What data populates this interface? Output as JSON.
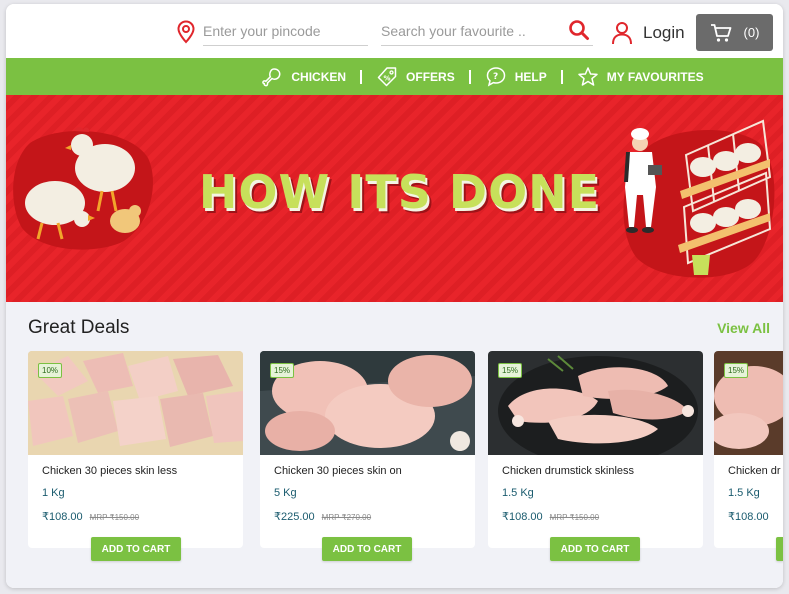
{
  "header": {
    "pincode_placeholder": "Enter your pincode",
    "search_placeholder": "Search your favourite ..",
    "login_label": "Login",
    "cart_count": "(0)"
  },
  "nav": {
    "items": [
      {
        "label": "CHICKEN",
        "icon": "chicken-leg-icon"
      },
      {
        "label": "OFFERS",
        "icon": "offer-tag-icon"
      },
      {
        "label": "HELP",
        "icon": "help-chat-icon"
      },
      {
        "label": "MY FAVOURITES",
        "icon": "star-icon"
      }
    ]
  },
  "banner": {
    "title": "HOW ITS DONE"
  },
  "deals": {
    "title": "Great Deals",
    "view_all": "View All",
    "products": [
      {
        "discount": "10%",
        "name": "Chicken 30 pieces skin less",
        "qty": "1 Kg",
        "price": "₹108.00",
        "mrp": "MRP ₹150.00",
        "add_label": "ADD TO CART"
      },
      {
        "discount": "15%",
        "name": "Chicken 30 pieces skin on",
        "qty": "5 Kg",
        "price": "₹225.00",
        "mrp": "MRP ₹270.00",
        "add_label": "ADD TO CART"
      },
      {
        "discount": "15%",
        "name": "Chicken drumstick skinless",
        "qty": "1.5 Kg",
        "price": "₹108.00",
        "mrp": "MRP ₹150.00",
        "add_label": "ADD TO CART"
      },
      {
        "discount": "15%",
        "name": "Chicken dr",
        "qty": "1.5 Kg",
        "price": "₹108.00",
        "mrp": "",
        "add_label": ""
      }
    ]
  },
  "colors": {
    "brand_green": "#7bc142",
    "banner_red": "#e8242a",
    "price_blue": "#1a5b6e"
  }
}
